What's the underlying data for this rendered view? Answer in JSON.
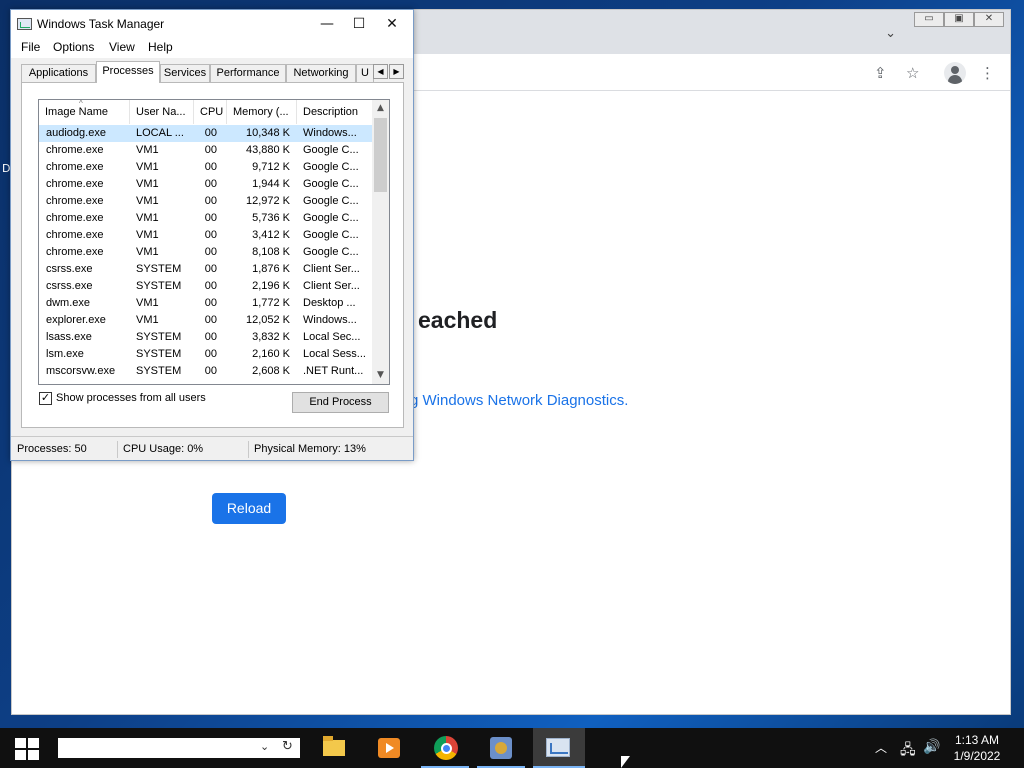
{
  "desktop": {
    "icon_label_fragment": "D"
  },
  "chrome": {
    "error_heading_fragment": "eached",
    "error_link_fragment": "g Windows Network Diagnostics.",
    "reload_label": "Reload",
    "window_controls": [
      "▭",
      "▣",
      "✕"
    ],
    "tab_menu_icon": "chevron-down-icon"
  },
  "taskmgr": {
    "title": "Windows Task Manager",
    "menus": [
      "File",
      "Options",
      "View",
      "Help"
    ],
    "tabs": [
      "Applications",
      "Processes",
      "Services",
      "Performance",
      "Networking",
      "U"
    ],
    "active_tab": "Processes",
    "columns": [
      "Image Name",
      "User Na...",
      "CPU",
      "Memory (...",
      "Description"
    ],
    "rows": [
      {
        "name": "audiodg.exe",
        "user": "LOCAL ...",
        "cpu": "00",
        "mem": "10,348 K",
        "desc": "Windows..."
      },
      {
        "name": "chrome.exe",
        "user": "VM1",
        "cpu": "00",
        "mem": "43,880 K",
        "desc": "Google C..."
      },
      {
        "name": "chrome.exe",
        "user": "VM1",
        "cpu": "00",
        "mem": "9,712 K",
        "desc": "Google C..."
      },
      {
        "name": "chrome.exe",
        "user": "VM1",
        "cpu": "00",
        "mem": "1,944 K",
        "desc": "Google C..."
      },
      {
        "name": "chrome.exe",
        "user": "VM1",
        "cpu": "00",
        "mem": "12,972 K",
        "desc": "Google C..."
      },
      {
        "name": "chrome.exe",
        "user": "VM1",
        "cpu": "00",
        "mem": "5,736 K",
        "desc": "Google C..."
      },
      {
        "name": "chrome.exe",
        "user": "VM1",
        "cpu": "00",
        "mem": "3,412 K",
        "desc": "Google C..."
      },
      {
        "name": "chrome.exe",
        "user": "VM1",
        "cpu": "00",
        "mem": "8,108 K",
        "desc": "Google C..."
      },
      {
        "name": "csrss.exe",
        "user": "SYSTEM",
        "cpu": "00",
        "mem": "1,876 K",
        "desc": "Client Ser..."
      },
      {
        "name": "csrss.exe",
        "user": "SYSTEM",
        "cpu": "00",
        "mem": "2,196 K",
        "desc": "Client Ser..."
      },
      {
        "name": "dwm.exe",
        "user": "VM1",
        "cpu": "00",
        "mem": "1,772 K",
        "desc": "Desktop ..."
      },
      {
        "name": "explorer.exe",
        "user": "VM1",
        "cpu": "00",
        "mem": "12,052 K",
        "desc": "Windows..."
      },
      {
        "name": "lsass.exe",
        "user": "SYSTEM",
        "cpu": "00",
        "mem": "3,832 K",
        "desc": "Local Sec..."
      },
      {
        "name": "lsm.exe",
        "user": "SYSTEM",
        "cpu": "00",
        "mem": "2,160 K",
        "desc": "Local Sess..."
      },
      {
        "name": "mscorsvw.exe",
        "user": "SYSTEM",
        "cpu": "00",
        "mem": "2,608 K",
        "desc": ".NET Runt..."
      }
    ],
    "selected_row": 0,
    "show_all_label": "Show processes from all users",
    "show_all_checked": true,
    "end_process_label": "End Process",
    "status": {
      "processes": "Processes: 50",
      "cpu": "CPU Usage: 0%",
      "memory": "Physical Memory: 13%"
    }
  },
  "taskbar": {
    "search_placeholder": "",
    "clock_time": "1:13 AM",
    "clock_date": "1/9/2022"
  },
  "colors": {
    "accent": "#1a73e8",
    "selection": "#cce8ff",
    "taskbar": "#101010"
  }
}
